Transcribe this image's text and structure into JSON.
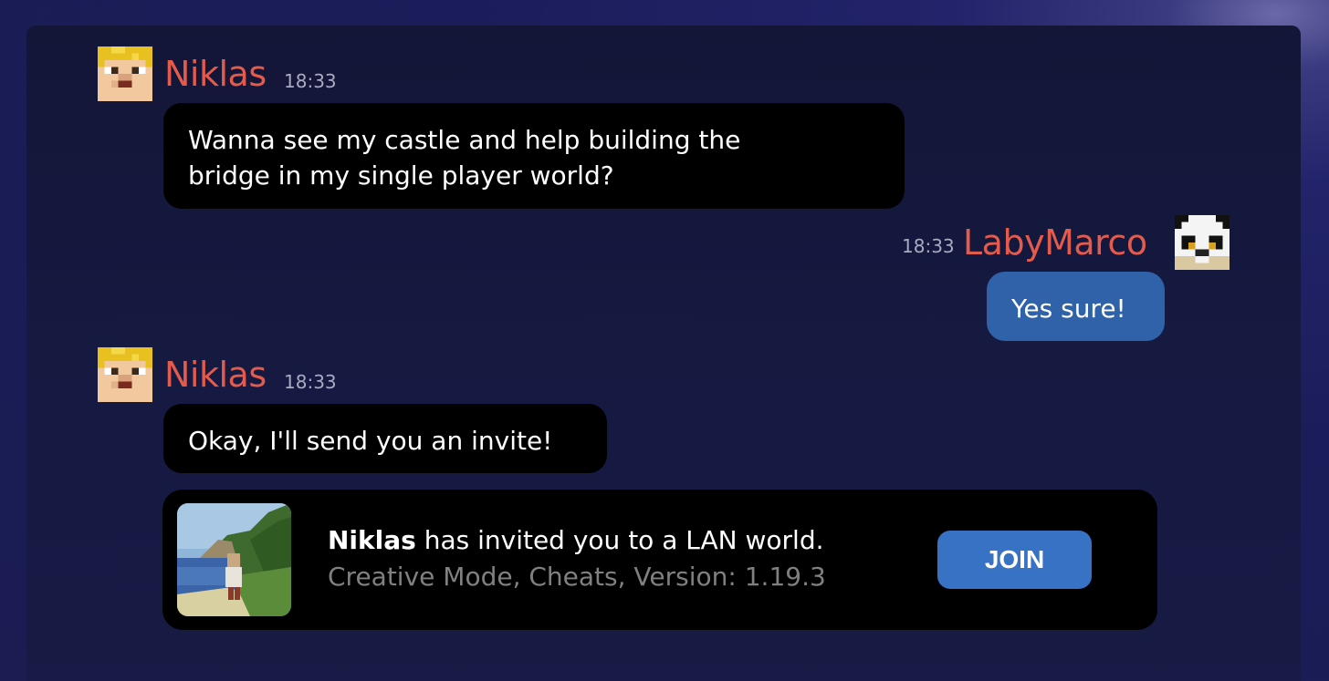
{
  "messages": [
    {
      "author": "Niklas",
      "time": "18:33",
      "lines": [
        "Wanna see my castle and help building the",
        "bridge in my single player world?"
      ]
    },
    {
      "author": "LabyMarco",
      "time": "18:33",
      "lines": [
        "Yes sure!"
      ]
    },
    {
      "author": "Niklas",
      "time": "18:33",
      "lines": [
        "Okay, I'll send you an invite!"
      ]
    }
  ],
  "invite": {
    "sender": "Niklas",
    "text": " has invited you to a LAN world.",
    "details": "Creative Mode, Cheats, Version: 1.19.3",
    "join_label": "JOIN"
  },
  "colors": {
    "name": "#e45b4c",
    "own_bubble": "#2f62a8",
    "join_button": "#3872c4"
  },
  "icons": {
    "niklas_avatar": "blond-skin-head-icon",
    "labymarco_avatar": "panda-skin-head-icon",
    "world_thumbnail": "world-preview-thumbnail"
  }
}
